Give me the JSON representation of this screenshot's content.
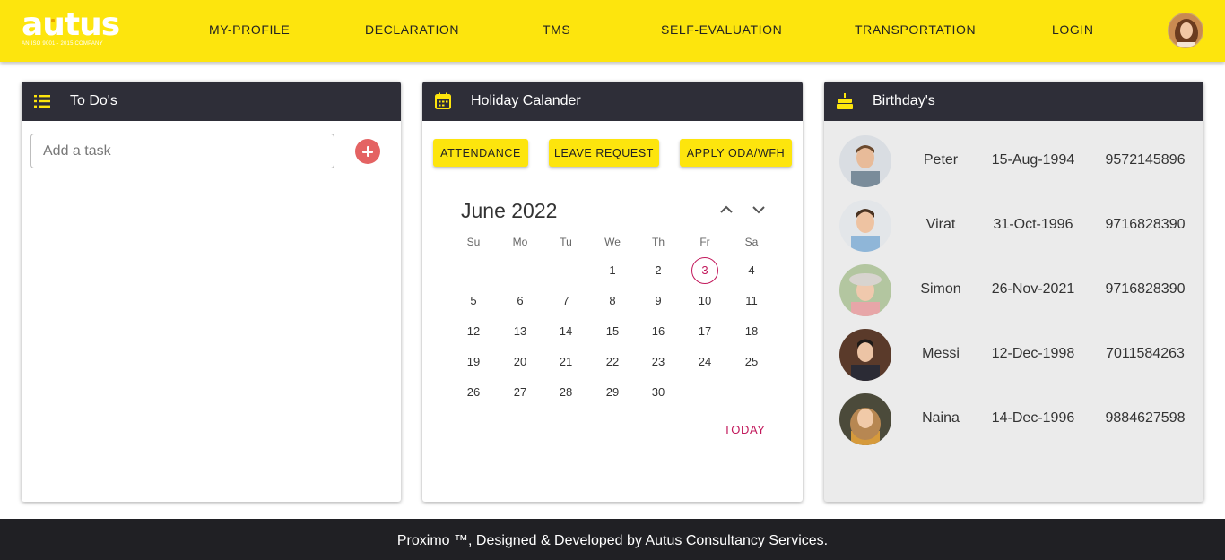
{
  "brand": {
    "logo_text": "autus",
    "logo_subtitle": "AN ISO 9001 - 2015 COMPANY",
    "colors": {
      "primary": "#fde50d",
      "header_dark": "#2e2e38",
      "accent": "#c2185b",
      "add": "#e46363"
    }
  },
  "nav": {
    "items": [
      {
        "label": "MY-PROFILE"
      },
      {
        "label": "DECLARATION"
      },
      {
        "label": "TMS"
      },
      {
        "label": "SELF-EVALUATION"
      },
      {
        "label": "TRANSPORTATION"
      },
      {
        "label": "LOGIN"
      }
    ],
    "avatar_icon": "user-avatar"
  },
  "todo": {
    "title": "To Do's",
    "icon": "list-icon",
    "input_placeholder": "Add a task",
    "add_icon": "plus-circle-icon"
  },
  "holiday": {
    "title": "Holiday Calander",
    "icon": "calendar-icon",
    "buttons": [
      {
        "label": "ATTENDANCE"
      },
      {
        "label": "LEAVE REQUEST"
      },
      {
        "label": "APPLY ODA/WFH"
      }
    ],
    "calendar": {
      "month_label": "June 2022",
      "weekdays": [
        "Su",
        "Mo",
        "Tu",
        "We",
        "Th",
        "Fr",
        "Sa"
      ],
      "first_weekday_index": 3,
      "days_in_month": 30,
      "selected_day": "3",
      "prev_icon": "chevron-up-icon",
      "next_icon": "chevron-down-icon",
      "today_label": "TODAY"
    }
  },
  "birthdays": {
    "title": "Birthday's",
    "icon": "cake-icon",
    "people": [
      {
        "name": "Peter",
        "date": "15-Aug-1994",
        "phone": "9572145896"
      },
      {
        "name": "Virat",
        "date": "31-Oct-1996",
        "phone": "9716828390"
      },
      {
        "name": "Simon",
        "date": "26-Nov-2021",
        "phone": "9716828390"
      },
      {
        "name": "Messi",
        "date": "12-Dec-1998",
        "phone": "7011584263"
      },
      {
        "name": "Naina",
        "date": "14-Dec-1996",
        "phone": "9884627598"
      }
    ]
  },
  "footer": {
    "text": "Proximo ™, Designed & Developed by Autus Consultancy Services."
  }
}
